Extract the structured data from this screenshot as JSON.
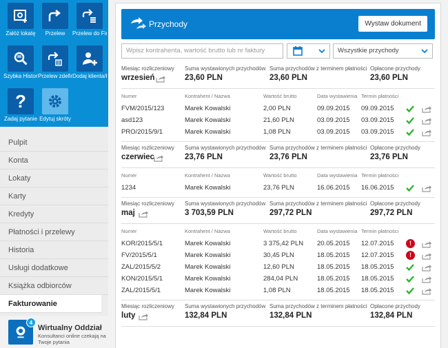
{
  "sidebar": {
    "tiles": [
      {
        "label": "Załóż lokatę",
        "icon": "deposit-icon"
      },
      {
        "label": "Przelew",
        "icon": "transfer-icon"
      },
      {
        "label": "Przelew do Firma Spr...",
        "icon": "transfer-company-icon"
      },
      {
        "label": "Szybka Historia oper...",
        "icon": "search-history-icon"
      },
      {
        "label": "Przelew zdefiniowany",
        "icon": "defined-transfer-icon"
      },
      {
        "label": "Dodaj klienta/kontr...",
        "icon": "add-client-icon"
      },
      {
        "label": "Zadaj pytanie",
        "icon": "question-icon"
      },
      {
        "label": "Edytuj skróty",
        "icon": "gear-icon"
      }
    ],
    "nav": [
      "Pulpit",
      "Konta",
      "Lokaty",
      "Karty",
      "Kredyty",
      "Płatności i przelewy",
      "Historia",
      "Usługi dodatkowe",
      "Książka odbiorców",
      "Fakturowanie"
    ],
    "active_nav": "Fakturowanie",
    "virtual_office": {
      "badge": "4",
      "title": "Wirtualny Oddział",
      "subtitle": "Konsultanci online czekają na Twoje pytania"
    }
  },
  "header": {
    "title": "Przychody",
    "button": "Wystaw dokument"
  },
  "filters": {
    "search_placeholder": "Wpisz kontrahenta, wartość brutto lub nr faktury",
    "select_value": "Wszystkie przychody"
  },
  "labels": {
    "month": "Miesiąc rozliczeniowy",
    "issued_sum": "Suma wystawionych przychodów",
    "due_sum": "Suma przychodów z terminem płatności",
    "paid": "Opłacone przychody",
    "col_number": "Numer",
    "col_contractor": "Kontrahent / Nazwa",
    "col_gross": "Wartość brutto",
    "col_issue_date": "Data wystawienia",
    "col_due_date": "Termin płatności"
  },
  "months": [
    {
      "month": "wrzesień",
      "issued": "23,60 PLN",
      "due": "23,60 PLN",
      "paid": "23,60 PLN",
      "invoices": [
        {
          "number": "FVM/2015/123",
          "contractor": "Marek Kowalski",
          "gross": "2,00 PLN",
          "issued": "09.09.2015",
          "due": "09.09.2015",
          "status": "ok"
        },
        {
          "number": "asd123",
          "contractor": "Marek Kowalski",
          "gross": "21,60 PLN",
          "issued": "03.09.2015",
          "due": "03.09.2015",
          "status": "ok"
        },
        {
          "number": "PRO/2015/9/1",
          "contractor": "Marek Kowalski",
          "gross": "1,08 PLN",
          "issued": "03.09.2015",
          "due": "03.09.2015",
          "status": "ok"
        }
      ]
    },
    {
      "month": "czerwiec",
      "issued": "23,76 PLN",
      "due": "23,76 PLN",
      "paid": "23,76 PLN",
      "invoices": [
        {
          "number": "1234",
          "contractor": "Marek Kowalski",
          "gross": "23,76 PLN",
          "issued": "16.06.2015",
          "due": "16.06.2015",
          "status": "ok"
        }
      ]
    },
    {
      "month": "maj",
      "issued": "3 703,59 PLN",
      "due": "297,72 PLN",
      "paid": "297,72 PLN",
      "invoices": [
        {
          "number": "KOR/2015/5/1",
          "contractor": "Marek Kowalski",
          "gross": "3 375,42 PLN",
          "issued": "20.05.2015",
          "due": "12.07.2015",
          "status": "warn"
        },
        {
          "number": "FV/2015/5/1",
          "contractor": "Marek Kowalski",
          "gross": "30,45 PLN",
          "issued": "18.05.2015",
          "due": "12.07.2015",
          "status": "warn"
        },
        {
          "number": "ZAL/2015/5/2",
          "contractor": "Marek Kowalski",
          "gross": "12,60 PLN",
          "issued": "18.05.2015",
          "due": "18.05.2015",
          "status": "ok"
        },
        {
          "number": "KON/2015/5/1",
          "contractor": "Marek Kowalski",
          "gross": "284,04 PLN",
          "issued": "18.05.2015",
          "due": "18.05.2015",
          "status": "ok"
        },
        {
          "number": "ZAL/2015/5/1",
          "contractor": "Marek Kowalski",
          "gross": "1,08 PLN",
          "issued": "18.05.2015",
          "due": "18.05.2015",
          "status": "ok"
        }
      ]
    },
    {
      "month": "luty",
      "issued": "132,84 PLN",
      "due": "132,84 PLN",
      "paid": "132,84 PLN",
      "invoices": []
    }
  ],
  "colors": {
    "brand_blue": "#0a7fd0",
    "ok_green": "#2db52d",
    "warn_red": "#d0021b"
  }
}
